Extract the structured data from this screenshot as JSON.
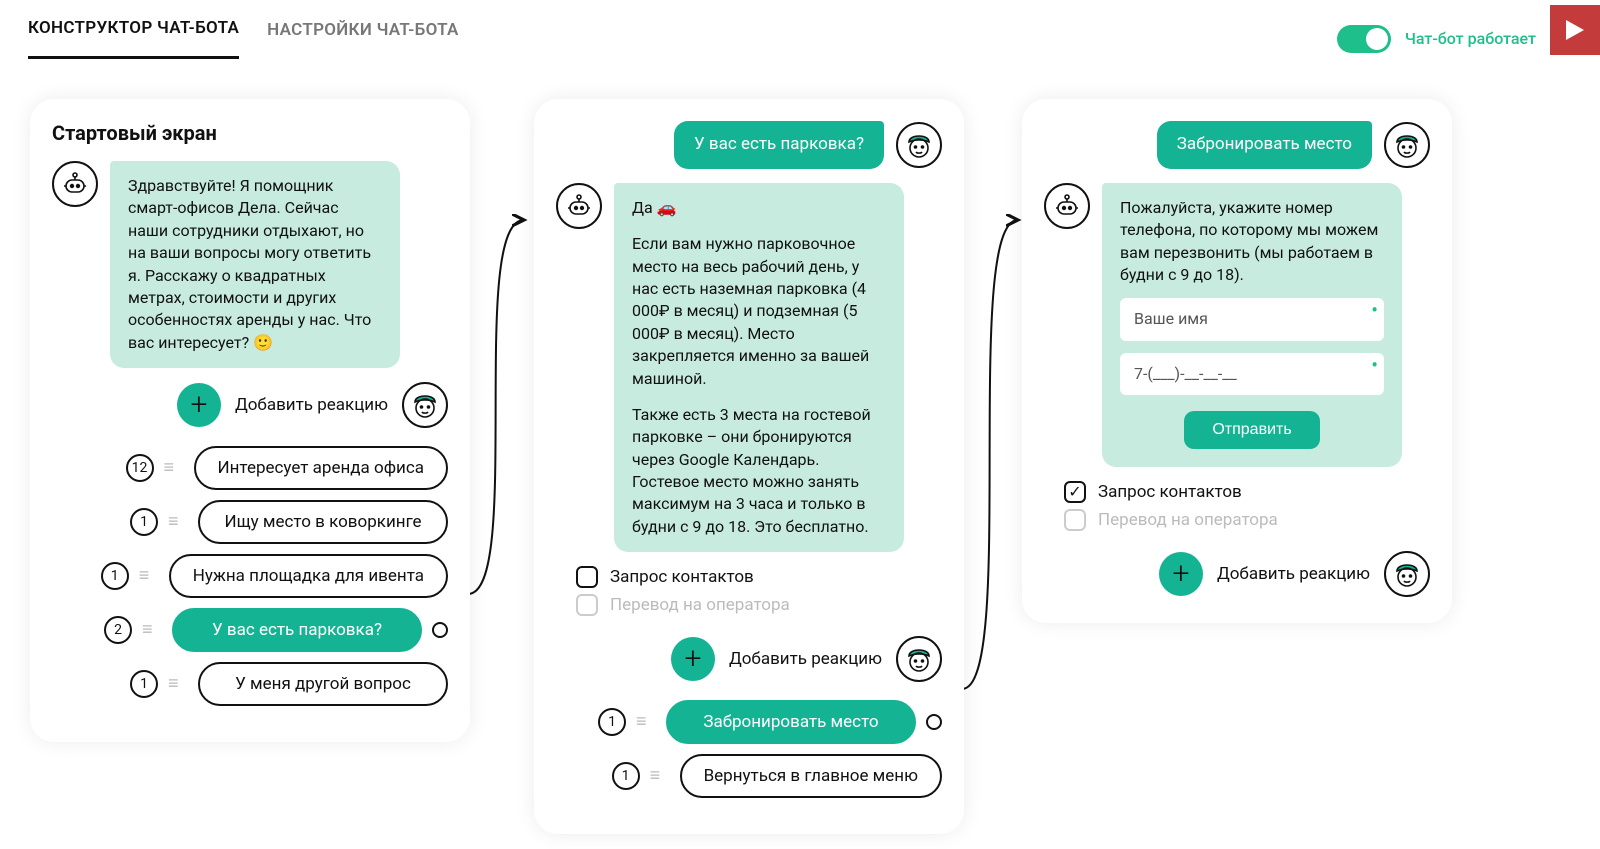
{
  "tabs": {
    "constructor": "КОНСТРУКТОР ЧАТ-БОТА",
    "settings": "НАСТРОЙКИ ЧАТ-БОТА"
  },
  "status": {
    "label": "Чат-бот работает"
  },
  "common": {
    "addReaction": "Добавить реакцию"
  },
  "checkboxes": {
    "requestContacts": "Запрос контактов",
    "transferOperator": "Перевод на оператора"
  },
  "card1": {
    "title": "Стартовый экран",
    "botMessage": "Здравствуйте! Я помощник смарт-офисов Дела. Сейчас наши сотрудники отдыхают, но на ваши вопросы могу ответить я. Расскажу о квадратных метрах, стоимости и других особенностях аренды у нас. Что вас интересует? 🙂",
    "options": [
      {
        "count": "12",
        "label": "Интересует аренда офиса",
        "selected": false
      },
      {
        "count": "1",
        "label": "Ищу место в коворкинге",
        "selected": false
      },
      {
        "count": "1",
        "label": "Нужна площадка для ивента",
        "selected": false
      },
      {
        "count": "2",
        "label": "У вас есть парковка?",
        "selected": true
      },
      {
        "count": "1",
        "label": "У меня другой вопрос",
        "selected": false
      }
    ]
  },
  "card2": {
    "userMessage": "У вас есть парковка?",
    "botP1": "Да 🚗",
    "botP2": "Если вам нужно парковочное место на весь рабочий день, у нас есть наземная парковка (4 000₽ в месяц) и подземная (5 000₽ в месяц). Место закрепляется именно за вашей машиной.",
    "botP3": "Также есть 3 места на гостевой парковке – они бронируются через Google Календарь. Гостевое место можно занять максимум на 3 часа и только в будни с 9 до 18. Это бесплатно.",
    "options": [
      {
        "count": "1",
        "label": "Забронировать место",
        "selected": true
      },
      {
        "count": "1",
        "label": "Вернуться в главное меню",
        "selected": false
      }
    ]
  },
  "card3": {
    "userMessage": "Забронировать место",
    "botMessage": "Пожалуйста, укажите номер телефона, по которому мы можем вам перезвонить (мы работаем в будни с 9 до 18).",
    "form": {
      "namePlaceholder": "Ваше имя",
      "phoneMask": "7-(___)-__-__-__",
      "submit": "Отправить"
    }
  }
}
